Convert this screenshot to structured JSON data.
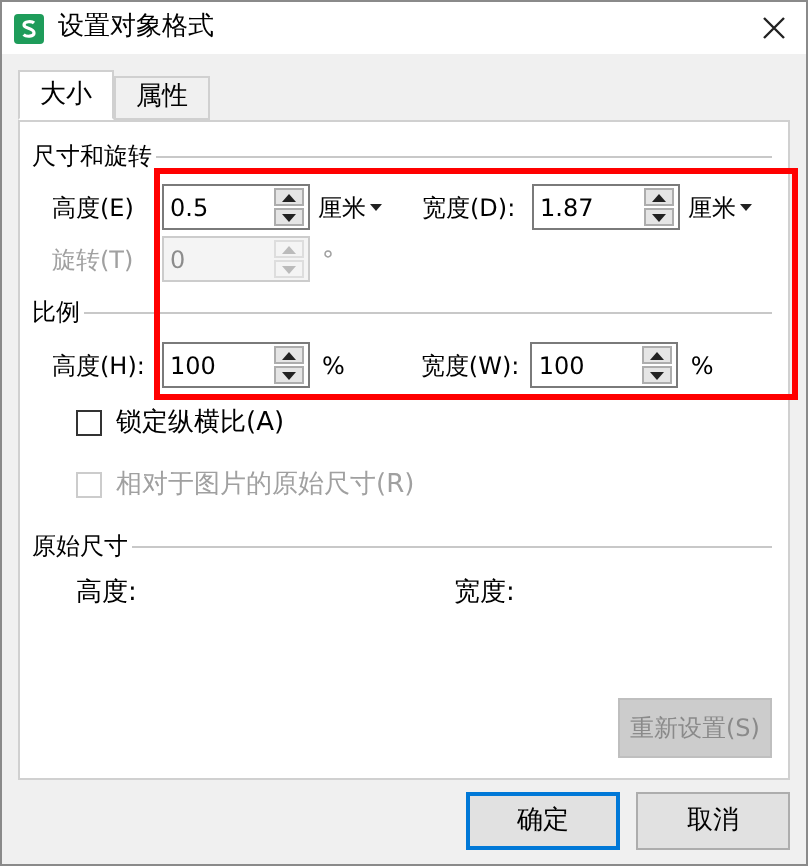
{
  "window": {
    "title": "设置对象格式"
  },
  "tabs": [
    {
      "label": "大小",
      "selected": true
    },
    {
      "label": "属性",
      "selected": false
    }
  ],
  "size_and_rotation": {
    "title": "尺寸和旋转",
    "height": {
      "label": "高度(E)",
      "value": "0.5",
      "unit": "厘米",
      "disabled": false
    },
    "width": {
      "label": "宽度(D):",
      "value": "1.87",
      "unit": "厘米",
      "disabled": false
    },
    "rotation": {
      "label": "旋转(T)",
      "value": "0",
      "unit": "°",
      "disabled": true
    }
  },
  "scale": {
    "title": "比例",
    "height": {
      "label": "高度(H):",
      "value": "100",
      "unit": "%",
      "disabled": false
    },
    "width": {
      "label": "宽度(W):",
      "value": "100",
      "unit": "%",
      "disabled": false
    }
  },
  "checkboxes": [
    {
      "label": "锁定纵横比(A)",
      "checked": false,
      "disabled": false
    },
    {
      "label": "相对于图片的原始尺寸(R)",
      "checked": false,
      "disabled": true
    }
  ],
  "original_size": {
    "title": "原始尺寸",
    "height_label": "高度:",
    "width_label": "宽度:"
  },
  "reset_button": {
    "label": "重新设置(S)",
    "disabled": true
  },
  "buttons": [
    {
      "label": "确定",
      "default": true
    },
    {
      "label": "取消",
      "default": false
    }
  ]
}
